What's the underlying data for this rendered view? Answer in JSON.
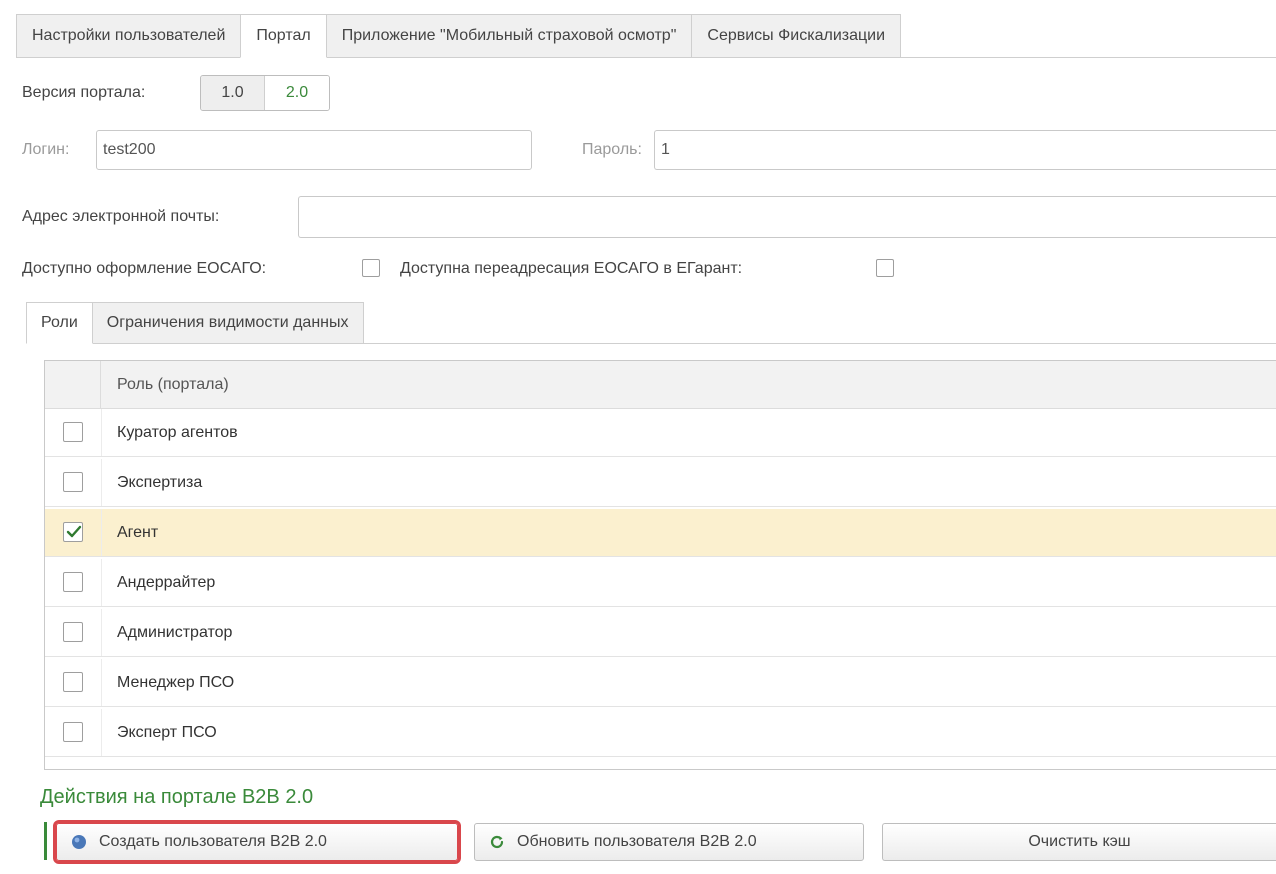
{
  "top_tabs": [
    {
      "label": "Настройки пользователей",
      "active": false
    },
    {
      "label": "Портал",
      "active": true
    },
    {
      "label": "Приложение \"Мобильный страховой осмотр\"",
      "active": false
    },
    {
      "label": "Сервисы Фискализации",
      "active": false
    }
  ],
  "portal_version": {
    "label": "Версия портала:",
    "options": [
      "1.0",
      "2.0"
    ],
    "selected": "2.0"
  },
  "login": {
    "label": "Логин:",
    "value": "test200"
  },
  "password": {
    "label": "Пароль:",
    "value": "1"
  },
  "email": {
    "label": "Адрес электронной почты:",
    "value": ""
  },
  "eosago": {
    "label": "Доступно оформление ЕОСАГО:",
    "checked": false
  },
  "eosago_redirect": {
    "label": "Доступна переадресация ЕОСАГО в ЕГарант:",
    "checked": false
  },
  "inner_tabs": [
    {
      "label": "Роли",
      "active": true
    },
    {
      "label": "Ограничения видимости данных",
      "active": false
    }
  ],
  "roles_table": {
    "header": "Роль (портала)",
    "rows": [
      {
        "label": "Куратор агентов",
        "checked": false
      },
      {
        "label": "Экспертиза",
        "checked": false
      },
      {
        "label": "Агент",
        "checked": true
      },
      {
        "label": "Андеррайтер",
        "checked": false
      },
      {
        "label": "Администратор",
        "checked": false
      },
      {
        "label": "Менеджер ПСО",
        "checked": false
      },
      {
        "label": "Эксперт ПСО",
        "checked": false
      }
    ]
  },
  "actions": {
    "title": "Действия на портале B2B 2.0",
    "create_label": "Создать пользователя B2B 2.0",
    "update_label": "Обновить пользователя B2B 2.0",
    "clear_cache_label": "Очистить кэш"
  },
  "colors": {
    "accent_green": "#3a8a3a",
    "highlight_row": "#fbf0cf",
    "create_button_outline": "#d9474c"
  },
  "icons": {
    "create": "globe-icon",
    "update": "refresh-icon",
    "checked": "checkmark-icon"
  }
}
